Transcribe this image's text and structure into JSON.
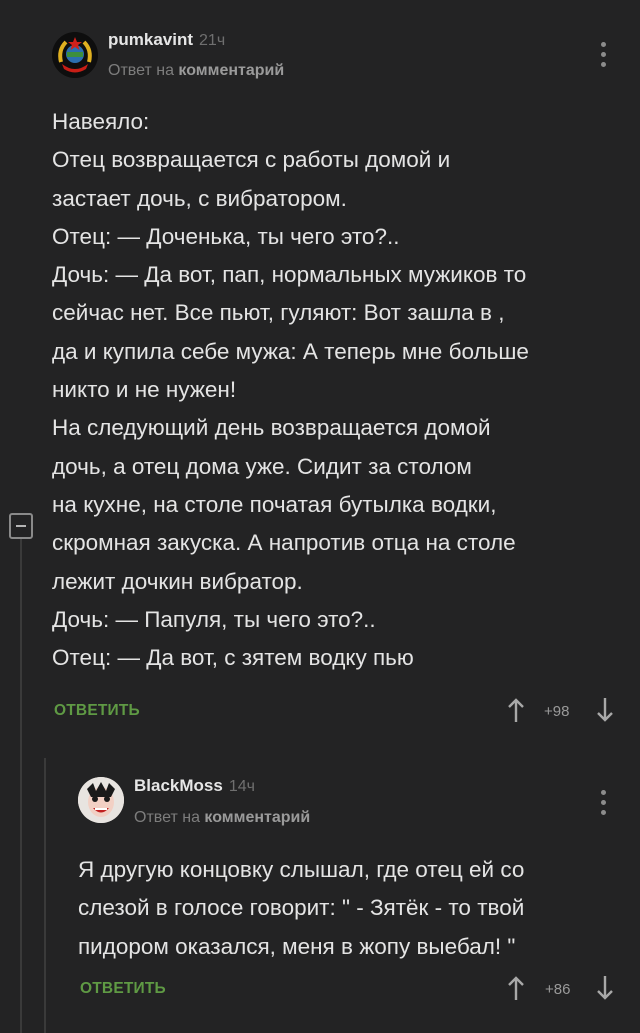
{
  "comments": [
    {
      "author": "pumkavint",
      "time": "21ч",
      "reply_prefix": "Ответ на",
      "reply_target": "комментарий",
      "lines": [
        "Навеяло:",
        "Отец возвращается с работы домой и",
        "застает дочь, с вибратором.",
        "Отец: — Доченька, ты чего это?..",
        "Дочь: — Да вот, пап, нормальных мужиков то",
        "сейчас нет. Все пьют, гуляют: Вот зашла в ,",
        "да и купила себе мужа: А теперь мне больше",
        "никто и не нужен!",
        "На следующий день возвращается домой",
        "дочь, а отец дома уже. Сидит за столом",
        "на кухне, на столе початая бутылка водки,",
        "скромная закуска. А напротив отца на столе",
        "лежит дочкин вибратор.",
        "Дочь: — Папуля, ты чего это?..",
        "Отец: — Да вот, с зятем водку пью"
      ],
      "reply_label": "ОТВЕТИТЬ",
      "rating": "+98"
    },
    {
      "author": "BlackMoss",
      "time": "14ч",
      "reply_prefix": "Ответ на",
      "reply_target": "комментарий",
      "lines": [
        "Я другую концовку слышал, где отец ей со",
        "слезой в голосе говорит: \" - Зятёк - то твой",
        "пидором оказался, меня в жопу выебал! \""
      ],
      "reply_label": "ОТВЕТИТЬ",
      "rating": "+86"
    }
  ],
  "icons": {
    "upvote": "arrow-up-icon",
    "downvote": "arrow-down-icon",
    "menu": "kebab-menu-icon",
    "collapse": "collapse-thread-icon"
  },
  "colors": {
    "background": "#232324",
    "accent_green": "#5f9a44"
  }
}
